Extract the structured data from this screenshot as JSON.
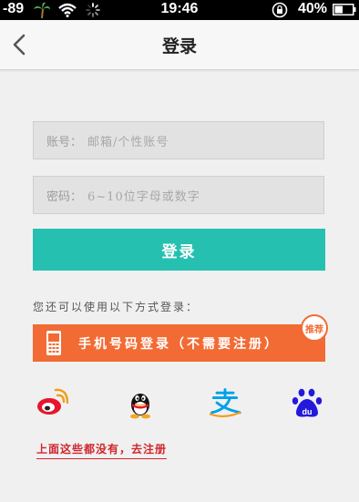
{
  "status_bar": {
    "signal": "-89",
    "time": "19:46",
    "battery": "40%",
    "icons": [
      "palm-tree-icon",
      "wifi-icon",
      "loading-spinner-icon",
      "rotation-lock-icon",
      "battery-icon"
    ]
  },
  "nav": {
    "title": "登录",
    "back_icon": "chevron-left-icon"
  },
  "form": {
    "account_label": "账号：",
    "account_placeholder": "邮箱/个性账号",
    "password_label": "密码：",
    "password_placeholder": "6~10位字母或数字",
    "login_button": "登录"
  },
  "alternatives": {
    "prompt": "您还可以使用以下方式登录：",
    "phone_login": "手机号码登录（不需要注册）",
    "badge": "推荐",
    "providers": [
      {
        "icon": "weibo-icon",
        "color": "#e6162d"
      },
      {
        "icon": "qq-icon",
        "color": "#000000"
      },
      {
        "icon": "alipay-icon",
        "color": "#00a0e9"
      },
      {
        "icon": "baidu-icon",
        "color": "#2319dc"
      }
    ]
  },
  "register_link": "上面这些都没有，去注册",
  "colors": {
    "accent": "#26c0b0",
    "phone_button": "#f26b34",
    "link": "#d0262d"
  }
}
